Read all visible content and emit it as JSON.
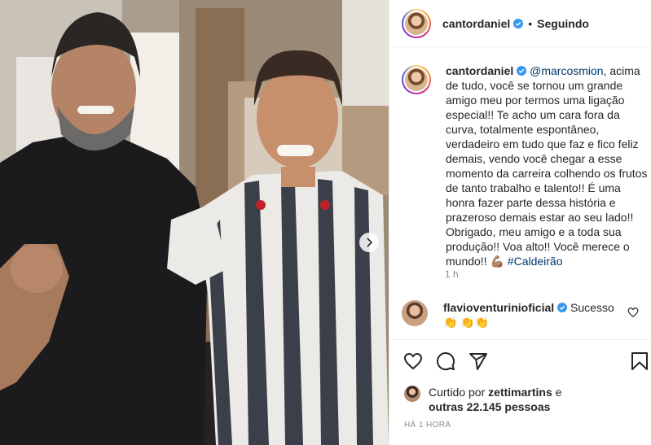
{
  "post": {
    "author": "cantordaniel",
    "following_label": "Seguindo",
    "separator": "•"
  },
  "caption": {
    "author": "cantordaniel",
    "mention": "@marcosmion",
    "text_1": ", acima de tudo, você se tornou um grande amigo meu por termos uma ligação especial!! Te acho um cara fora da curva, totalmente espontâneo, verdadeiro em tudo que faz e fico feliz demais, vendo você chegar a esse momento da carreira colhendo os frutos de tanto trabalho e talento!! É uma honra fazer parte dessa história e prazeroso demais estar ao seu lado!! Obrigado, meu amigo e a toda sua produção!! Voa alto!! Você merece o mundo!! 💪🏽 ",
    "hashtag": "#Caldeirão",
    "time": "1 h"
  },
  "comment": {
    "author": "flavioventurinioficial",
    "text": " Sucesso 👏 👏👏"
  },
  "likes": {
    "prefix": "Curtido por ",
    "user": "zettimartins",
    "middle": " e ",
    "others": "outras 22.145 pessoas"
  },
  "timestamp": "HÁ 1 HORA",
  "colors": {
    "verified": "#3897f0",
    "link": "#00376b",
    "muted": "#8e8e8e",
    "text": "#262626"
  },
  "icons": {
    "like": "heart-icon",
    "comment": "comment-icon",
    "share": "share-icon",
    "save": "bookmark-icon",
    "next": "chevron-right-icon",
    "verified": "verified-badge-icon"
  }
}
